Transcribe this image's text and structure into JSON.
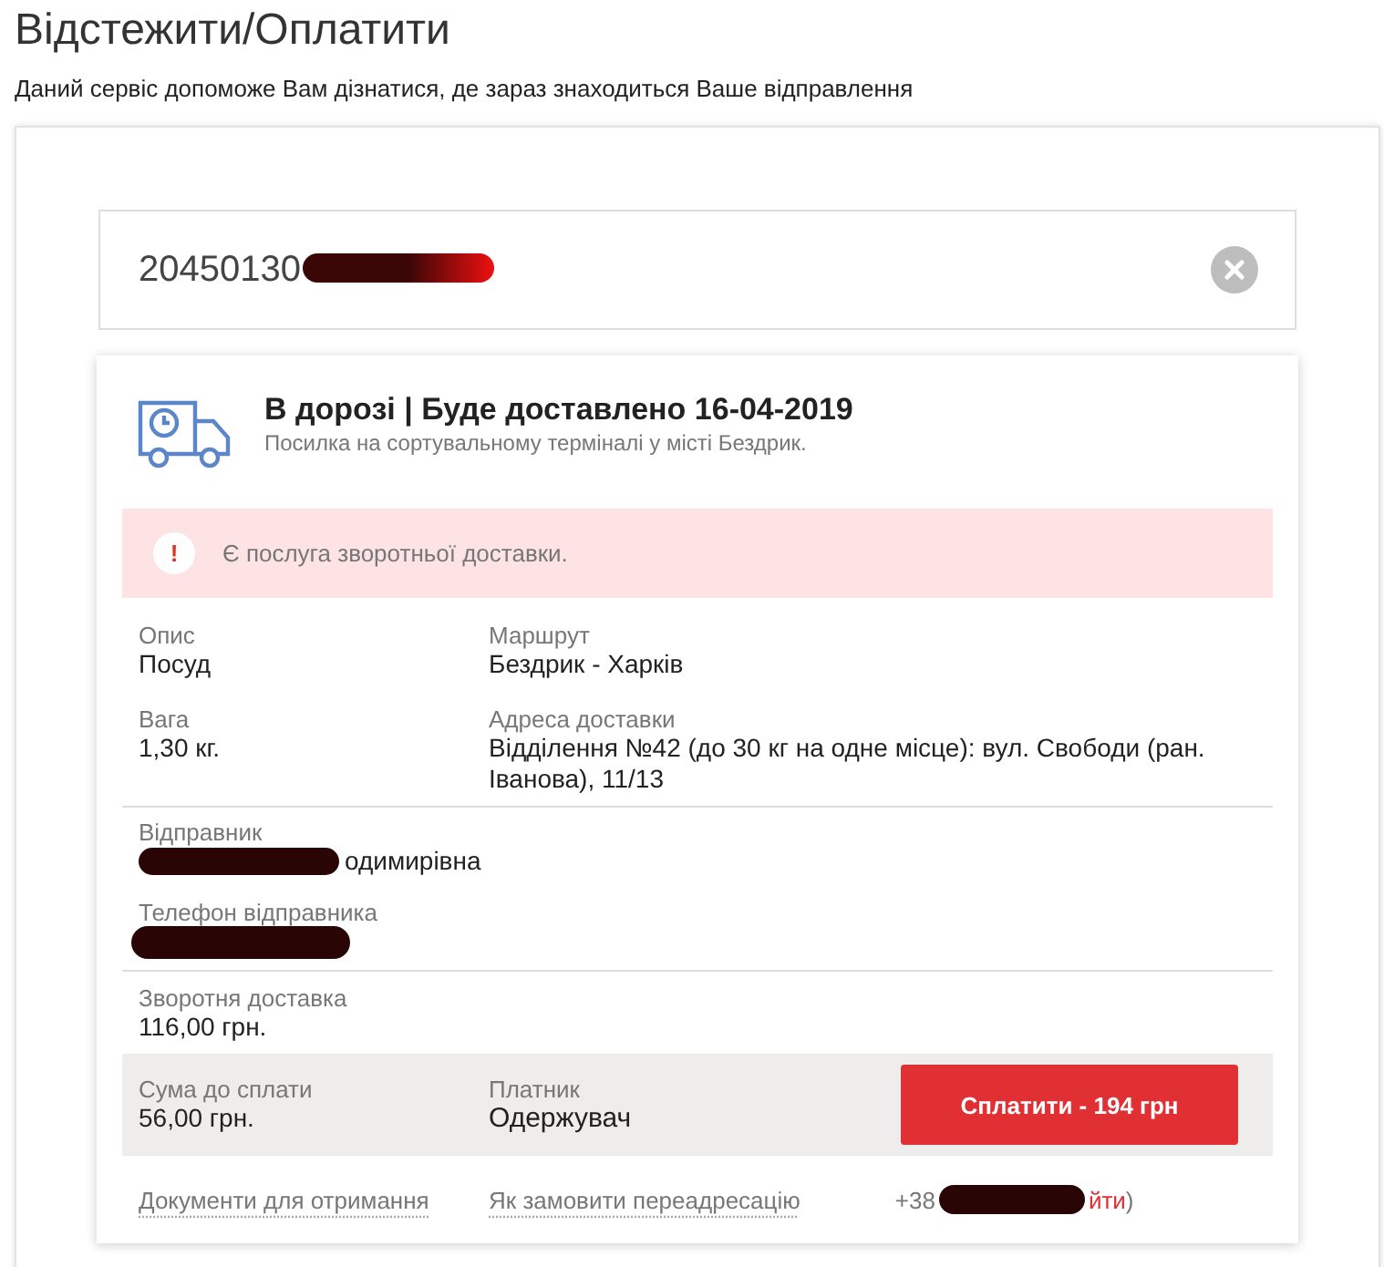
{
  "title": "Відстежити/Оплатити",
  "subtitle": "Даний сервіс допоможе Вам дізнатися, де зараз знаходиться Ваше відправлення",
  "search": {
    "value": "20450130",
    "redacted": true
  },
  "status": {
    "title": "В дорозі | Буде доставлено 16-04-2019",
    "detail": "Посилка на сортувальному терміналі у місті Бездрик."
  },
  "alert": {
    "icon": "!",
    "text": "Є послуга зворотньої доставки."
  },
  "details": [
    {
      "label": "Опис",
      "value": "Посуд"
    },
    {
      "label": "Маршрут",
      "value": "Бездрик - Харків"
    },
    {
      "label": "Вага",
      "value": "1,30 кг."
    },
    {
      "label": "Адреса доставки",
      "value": "Відділення №42 (до 30 кг на одне місце): вул. Свободи (ран. Іванова), 11/13"
    }
  ],
  "sender": {
    "label": "Відправник",
    "value": "одимирівна",
    "redacted": true
  },
  "sender_phone": {
    "label": "Телефон відправника",
    "redacted": true
  },
  "cod": {
    "label": "Зворотня доставка",
    "value": "116,00 грн."
  },
  "payment": {
    "amount_label": "Сума до сплати",
    "amount": "56,00 грн.",
    "payer_label": "Платник",
    "payer": "Одержувач",
    "button": "Сплатити - 194 грн"
  },
  "footer": {
    "links": [
      "Документи для отримання",
      "Як замовити переадресацію"
    ],
    "phone_prefix": "+38",
    "logout": "йти",
    "suffix": ")"
  }
}
